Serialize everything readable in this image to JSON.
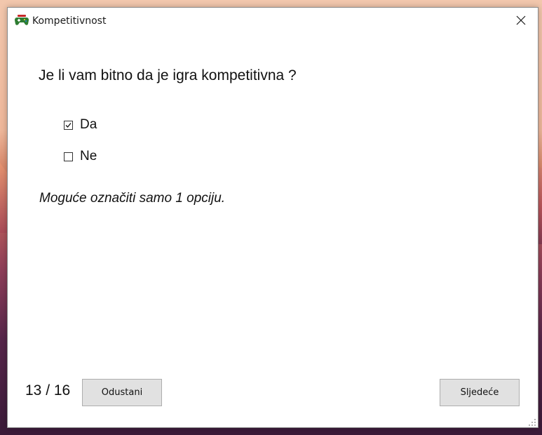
{
  "window": {
    "title": "Kompetitivnost",
    "app_icon": "gamepad-icon",
    "close_icon": "close-icon"
  },
  "question": {
    "text": "Je li vam bitno da je igra kompetitivna ?"
  },
  "options": [
    {
      "label": "Da",
      "checked": true
    },
    {
      "label": "Ne",
      "checked": false
    }
  ],
  "hint": "Moguće označiti samo 1 opciju.",
  "footer": {
    "counter": "13 / 16",
    "cancel_label": "Odustani",
    "next_label": "Sljedeće"
  },
  "colors": {
    "window_bg": "#ffffff",
    "button_bg": "#e1e1e1",
    "button_border": "#adadad",
    "text": "#111111"
  }
}
